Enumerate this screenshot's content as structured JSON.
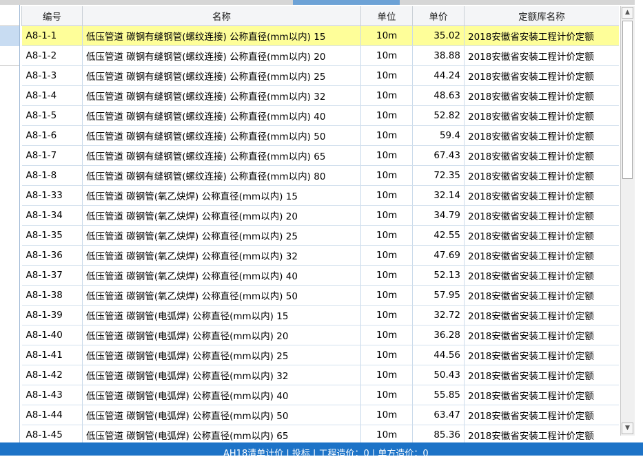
{
  "columns": [
    "编号",
    "名称",
    "单位",
    "单价",
    "定额库名称"
  ],
  "rows": [
    {
      "code": "A8-1-1",
      "name": "低压管道 碳钢有缝钢管(螺纹连接) 公称直径(mm以内) 15",
      "unit": "10m",
      "price": "35.02",
      "lib": "2018安徽省安装工程计价定额"
    },
    {
      "code": "A8-1-2",
      "name": "低压管道 碳钢有缝钢管(螺纹连接) 公称直径(mm以内) 20",
      "unit": "10m",
      "price": "38.88",
      "lib": "2018安徽省安装工程计价定额"
    },
    {
      "code": "A8-1-3",
      "name": "低压管道 碳钢有缝钢管(螺纹连接) 公称直径(mm以内) 25",
      "unit": "10m",
      "price": "44.24",
      "lib": "2018安徽省安装工程计价定额"
    },
    {
      "code": "A8-1-4",
      "name": "低压管道 碳钢有缝钢管(螺纹连接) 公称直径(mm以内) 32",
      "unit": "10m",
      "price": "48.63",
      "lib": "2018安徽省安装工程计价定额"
    },
    {
      "code": "A8-1-5",
      "name": "低压管道 碳钢有缝钢管(螺纹连接) 公称直径(mm以内) 40",
      "unit": "10m",
      "price": "52.82",
      "lib": "2018安徽省安装工程计价定额"
    },
    {
      "code": "A8-1-6",
      "name": "低压管道 碳钢有缝钢管(螺纹连接) 公称直径(mm以内) 50",
      "unit": "10m",
      "price": "59.4",
      "lib": "2018安徽省安装工程计价定额"
    },
    {
      "code": "A8-1-7",
      "name": "低压管道 碳钢有缝钢管(螺纹连接) 公称直径(mm以内) 65",
      "unit": "10m",
      "price": "67.43",
      "lib": "2018安徽省安装工程计价定额"
    },
    {
      "code": "A8-1-8",
      "name": "低压管道 碳钢有缝钢管(螺纹连接) 公称直径(mm以内) 80",
      "unit": "10m",
      "price": "72.35",
      "lib": "2018安徽省安装工程计价定额"
    },
    {
      "code": "A8-1-33",
      "name": "低压管道 碳钢管(氧乙炔焊) 公称直径(mm以内) 15",
      "unit": "10m",
      "price": "32.14",
      "lib": "2018安徽省安装工程计价定额"
    },
    {
      "code": "A8-1-34",
      "name": "低压管道 碳钢管(氧乙炔焊) 公称直径(mm以内) 20",
      "unit": "10m",
      "price": "34.79",
      "lib": "2018安徽省安装工程计价定额"
    },
    {
      "code": "A8-1-35",
      "name": "低压管道 碳钢管(氧乙炔焊) 公称直径(mm以内) 25",
      "unit": "10m",
      "price": "42.55",
      "lib": "2018安徽省安装工程计价定额"
    },
    {
      "code": "A8-1-36",
      "name": "低压管道 碳钢管(氧乙炔焊) 公称直径(mm以内) 32",
      "unit": "10m",
      "price": "47.69",
      "lib": "2018安徽省安装工程计价定额"
    },
    {
      "code": "A8-1-37",
      "name": "低压管道 碳钢管(氧乙炔焊) 公称直径(mm以内) 40",
      "unit": "10m",
      "price": "52.13",
      "lib": "2018安徽省安装工程计价定额"
    },
    {
      "code": "A8-1-38",
      "name": "低压管道 碳钢管(氧乙炔焊) 公称直径(mm以内) 50",
      "unit": "10m",
      "price": "57.95",
      "lib": "2018安徽省安装工程计价定额"
    },
    {
      "code": "A8-1-39",
      "name": "低压管道 碳钢管(电弧焊) 公称直径(mm以内) 15",
      "unit": "10m",
      "price": "32.72",
      "lib": "2018安徽省安装工程计价定额"
    },
    {
      "code": "A8-1-40",
      "name": "低压管道 碳钢管(电弧焊) 公称直径(mm以内) 20",
      "unit": "10m",
      "price": "36.28",
      "lib": "2018安徽省安装工程计价定额"
    },
    {
      "code": "A8-1-41",
      "name": "低压管道 碳钢管(电弧焊) 公称直径(mm以内) 25",
      "unit": "10m",
      "price": "44.56",
      "lib": "2018安徽省安装工程计价定额"
    },
    {
      "code": "A8-1-42",
      "name": "低压管道 碳钢管(电弧焊) 公称直径(mm以内) 32",
      "unit": "10m",
      "price": "50.43",
      "lib": "2018安徽省安装工程计价定额"
    },
    {
      "code": "A8-1-43",
      "name": "低压管道 碳钢管(电弧焊) 公称直径(mm以内) 40",
      "unit": "10m",
      "price": "55.85",
      "lib": "2018安徽省安装工程计价定额"
    },
    {
      "code": "A8-1-44",
      "name": "低压管道 碳钢管(电弧焊) 公称直径(mm以内) 50",
      "unit": "10m",
      "price": "63.47",
      "lib": "2018安徽省安装工程计价定额"
    },
    {
      "code": "A8-1-45",
      "name": "低压管道 碳钢管(电弧焊) 公称直径(mm以内) 65",
      "unit": "10m",
      "price": "85.36",
      "lib": "2018安徽省安装工程计价定额"
    }
  ],
  "selected_row": 0,
  "colors": {
    "selected_row": "#fefe99",
    "statusbar": "#1d73c7",
    "grid_line": "#c9d9ea"
  },
  "scrollbar": {
    "up_icon": "arrow-up-icon",
    "down_icon": "arrow-down-icon"
  },
  "statusbar": {
    "text": "AH18清单计价 | 投标 | 工程造价：0 | 单方造价：0"
  }
}
